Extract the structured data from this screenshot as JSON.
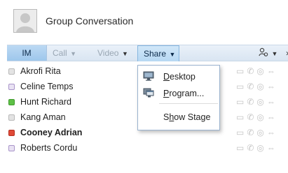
{
  "header": {
    "title": "Group Conversation"
  },
  "toolbar": {
    "im_label": "IM",
    "call_label": "Call",
    "video_label": "Video",
    "share_label": "Share",
    "more_label": "›"
  },
  "participants": [
    {
      "name": "Akrofi Rita",
      "status": "offline",
      "bold": false
    },
    {
      "name": "Celine Temps",
      "status": "mobile",
      "bold": false
    },
    {
      "name": "Hunt Richard",
      "status": "available",
      "bold": false
    },
    {
      "name": "Kang Aman",
      "status": "offline",
      "bold": false
    },
    {
      "name": "Cooney Adrian",
      "status": "busy",
      "bold": true
    },
    {
      "name": "Roberts Cordu",
      "status": "mobile",
      "bold": false
    }
  ],
  "share_menu": {
    "items": [
      {
        "label_first": "D",
        "label_rest": "esktop",
        "icon": "desktop-icon"
      },
      {
        "label_first": "P",
        "label_rest": "rogram...",
        "icon": "program-icon"
      },
      {
        "label_pre": "S",
        "label_ul": "h",
        "label_post": "ow Stage"
      }
    ]
  },
  "colors": {
    "toolbar_bg": "#d9e5f2",
    "accent": "#9ec7ec",
    "available": "#5ec046",
    "busy": "#e04a37"
  }
}
